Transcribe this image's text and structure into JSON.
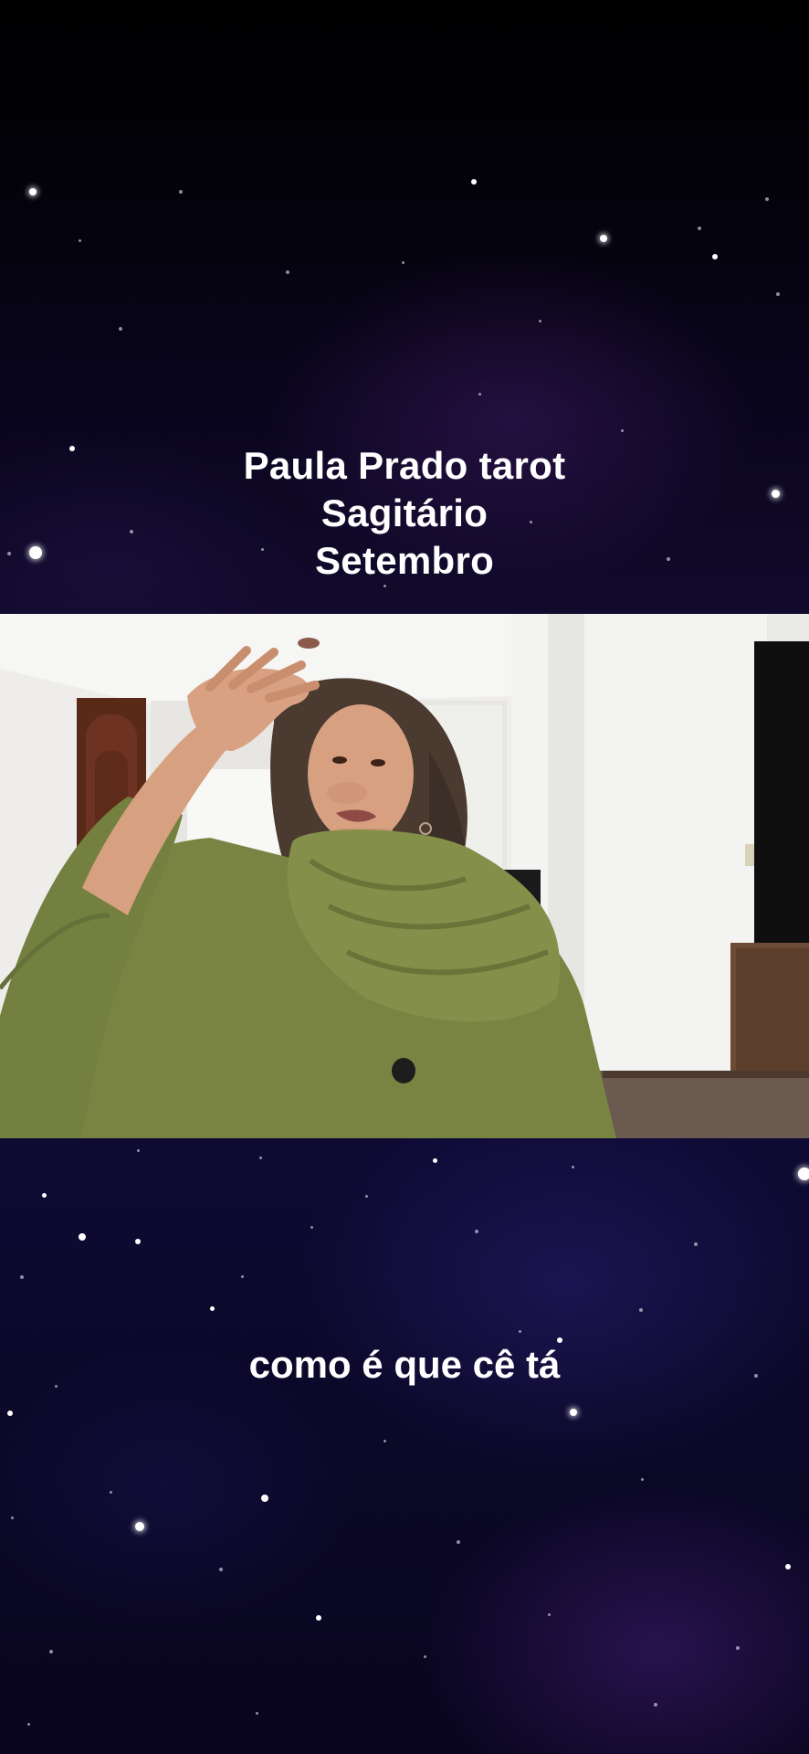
{
  "overlay_title": {
    "line1": "Paula Prado tarot",
    "line2": "Sagitário",
    "line3": "Setembro"
  },
  "subtitle": {
    "text": "como é que cê tá"
  },
  "video_frame": {
    "subject": "person-in-green-sweater"
  },
  "colors": {
    "sweater": "#7a8442",
    "wall": "#efeeec",
    "door": "#5a2a18",
    "sky_top": "#0b0620",
    "sky_bottom": "#0e0a34"
  }
}
